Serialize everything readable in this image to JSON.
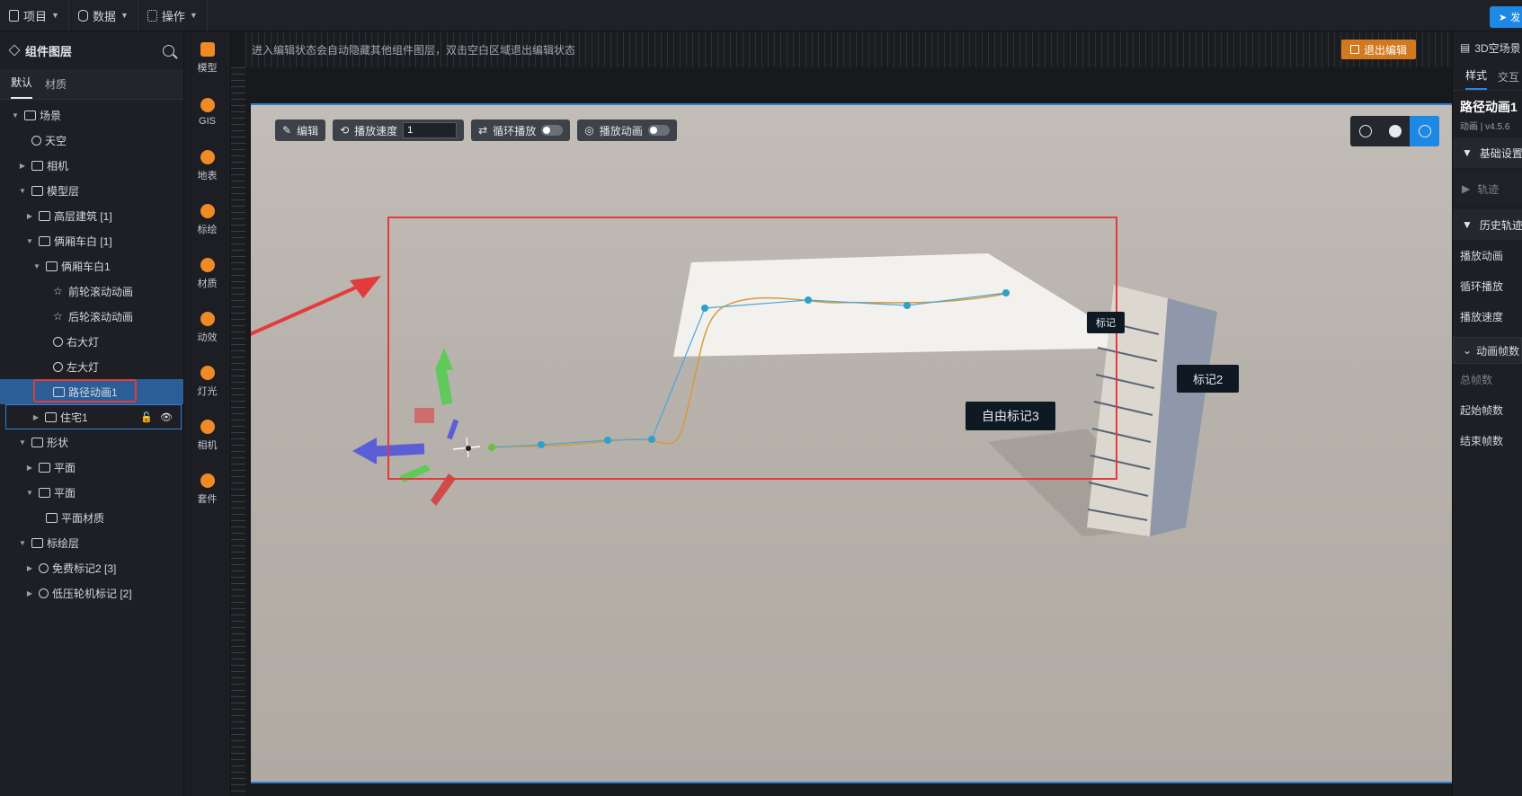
{
  "topbar": {
    "menus": [
      {
        "label": "项目",
        "icon": "document-icon"
      },
      {
        "label": "数据",
        "icon": "database-icon"
      },
      {
        "label": "操作",
        "icon": "grid-icon"
      }
    ],
    "publish_label": "发"
  },
  "layers": {
    "title": "组件图层",
    "tabs": [
      "默认",
      "材质"
    ],
    "tree": [
      {
        "label": "场景",
        "level": 0,
        "arrow": "down",
        "icon": "scene-icon"
      },
      {
        "label": "天空",
        "level": 1,
        "arrow": "",
        "icon": "sky-icon"
      },
      {
        "label": "相机",
        "level": 1,
        "arrow": "right",
        "icon": "folder-icon"
      },
      {
        "label": "模型层",
        "level": 1,
        "arrow": "down",
        "icon": "folder-icon"
      },
      {
        "label": "高层建筑 [1]",
        "level": 2,
        "arrow": "right",
        "icon": "folder-icon"
      },
      {
        "label": "俩厢车白 [1]",
        "level": 2,
        "arrow": "down",
        "icon": "folder-icon"
      },
      {
        "label": "俩厢车白1",
        "level": 3,
        "arrow": "down",
        "icon": "model-icon"
      },
      {
        "label": "前轮滚动动画",
        "level": 4,
        "arrow": "",
        "icon": "star-icon"
      },
      {
        "label": "后轮滚动动画",
        "level": 4,
        "arrow": "",
        "icon": "star-icon"
      },
      {
        "label": "右大灯",
        "level": 4,
        "arrow": "",
        "icon": "light-icon"
      },
      {
        "label": "左大灯",
        "level": 4,
        "arrow": "",
        "icon": "light-icon"
      },
      {
        "label": "路径动画1",
        "level": 4,
        "arrow": "",
        "icon": "path-icon",
        "selected": true
      },
      {
        "label": "住宅1",
        "level": 2,
        "arrow": "right",
        "icon": "cube-icon",
        "outlined": true
      },
      {
        "label": "形状",
        "level": 1,
        "arrow": "down",
        "icon": "folder-icon"
      },
      {
        "label": "平面",
        "level": 2,
        "arrow": "right",
        "icon": "plane-icon"
      },
      {
        "label": "平面",
        "level": 2,
        "arrow": "down",
        "icon": "plane-icon"
      },
      {
        "label": "平面材质",
        "level": 3,
        "arrow": "",
        "icon": "material-icon"
      },
      {
        "label": "标绘层",
        "level": 1,
        "arrow": "down",
        "icon": "folder-icon"
      },
      {
        "label": "免费标记2 [3]",
        "level": 2,
        "arrow": "right",
        "icon": "marker-icon"
      },
      {
        "label": "低压轮机标记 [2]",
        "level": 2,
        "arrow": "right",
        "icon": "marker-icon"
      }
    ]
  },
  "components": [
    {
      "label": "模型",
      "icon": "model-icon"
    },
    {
      "label": "GIS",
      "icon": "gis-icon"
    },
    {
      "label": "地表",
      "icon": "terrain-icon"
    },
    {
      "label": "标绘",
      "icon": "pin-icon"
    },
    {
      "label": "材质",
      "icon": "material-icon"
    },
    {
      "label": "动效",
      "icon": "effect-icon"
    },
    {
      "label": "灯光",
      "icon": "light-icon"
    },
    {
      "label": "相机",
      "icon": "camera-icon"
    },
    {
      "label": "套件",
      "icon": "kit-icon"
    }
  ],
  "canvas": {
    "hint": "进入编辑状态会自动隐藏其他组件图层，双击空白区域退出编辑状态",
    "exit_label": "退出编辑",
    "toolbar": {
      "edit_label": "编辑",
      "speed_label": "播放速度",
      "speed_value": "1",
      "loop_label": "循环播放",
      "play_label": "播放动画"
    },
    "tags": [
      "自由标记3",
      "标记2",
      "标记"
    ]
  },
  "props": {
    "header": "3D空场景",
    "tabs": [
      "样式",
      "交互"
    ],
    "title": "路径动画1",
    "subtitle": "动画 | v4.5.6",
    "sections": {
      "basic": "基础设置",
      "track": "轨迹",
      "history": "历史轨迹"
    },
    "rows": {
      "play": "播放动画",
      "loop": "循环播放",
      "speed": "播放速度",
      "frames": "动画帧数",
      "total": "总帧数",
      "start": "起始帧数",
      "end": "结束帧数"
    }
  },
  "colors": {
    "accent": "#1e88e5",
    "highlight_red": "#e23b3b",
    "exit_orange": "#d2781d"
  }
}
